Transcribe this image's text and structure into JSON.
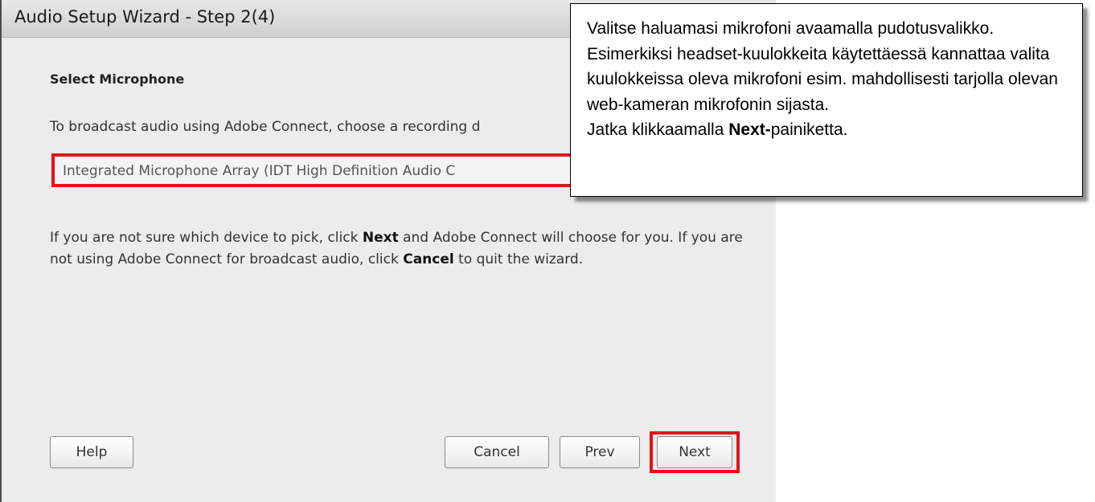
{
  "dialog": {
    "title": "Audio Setup Wizard - Step 2(4)",
    "section_heading": "Select Microphone",
    "instruction": "To broadcast audio using Adobe Connect, choose a recording d",
    "microphone_select": {
      "selected_value": "Integrated Microphone Array (IDT High Definition Audio C"
    },
    "info": {
      "part1": "If you are not sure which device to pick, click ",
      "next_word": "Next",
      "part2": " and Adobe Connect will choose for you. If you are not using Adobe Connect for broadcast audio, click ",
      "cancel_word": "Cancel",
      "part3": " to quit the wizard."
    },
    "buttons": {
      "help": "Help",
      "cancel": "Cancel",
      "prev": "Prev",
      "next": "Next"
    }
  },
  "callout": {
    "text": "Valitse haluamasi mikrofoni avaamalla pudotusvalikko. Esimerkiksi headset-kuulokkeita käytettäessä kannattaa valita kuulokkeissa oleva mikrofoni esim. mahdollisesti tarjolla olevan web-kameran mikrofonin sijasta.",
    "continue_prefix": "Jatka klikkaamalla ",
    "continue_bold": "Next-",
    "continue_suffix": "painiketta."
  },
  "colors": {
    "highlight_border": "#e3121b",
    "dialog_background": "#ececec",
    "titlebar": "#d8d8d8"
  }
}
